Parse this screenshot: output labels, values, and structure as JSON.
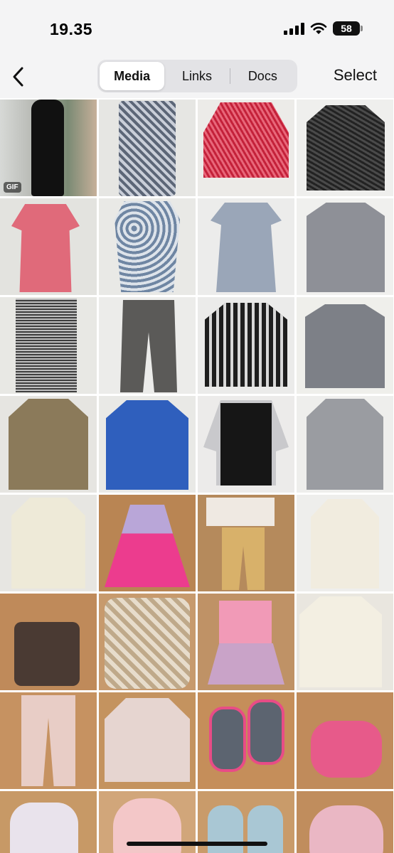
{
  "status_bar": {
    "time": "19.35",
    "battery_level": "58"
  },
  "nav": {
    "back_icon": "chevron-left-icon",
    "tabs": [
      {
        "label": "Media",
        "active": true
      },
      {
        "label": "Links",
        "active": false
      },
      {
        "label": "Docs",
        "active": false
      }
    ],
    "select_label": "Select"
  },
  "media": {
    "items": [
      {
        "kind": "black long dress",
        "badge": "GIF"
      },
      {
        "kind": "grey patterned tunic"
      },
      {
        "kind": "red lace top"
      },
      {
        "kind": "black lace peplum top"
      },
      {
        "kind": "pink child dress"
      },
      {
        "kind": "floral child dress"
      },
      {
        "kind": "grey child dress"
      },
      {
        "kind": "grey double-breasted coat"
      },
      {
        "kind": "grey tweed dress"
      },
      {
        "kind": "grey trousers"
      },
      {
        "kind": "black plaid jacket"
      },
      {
        "kind": "grey jacket"
      },
      {
        "kind": "khaki shirt dress"
      },
      {
        "kind": "blue blouse"
      },
      {
        "kind": "black dress with white collar"
      },
      {
        "kind": "grey shirt dress"
      },
      {
        "kind": "cream blouse"
      },
      {
        "kind": "pink child dress"
      },
      {
        "kind": "child top and leggings"
      },
      {
        "kind": "cream ruffle blouse"
      },
      {
        "kind": "baby carrier"
      },
      {
        "kind": "swaddle blanket set"
      },
      {
        "kind": "pink tee and skirt"
      },
      {
        "kind": "cream blouse"
      },
      {
        "kind": "pink leggings"
      },
      {
        "kind": "printed long sleeve tee"
      },
      {
        "kind": "pink grey sneakers"
      },
      {
        "kind": "sneaker detail"
      },
      {
        "kind": "unicorn shoe"
      },
      {
        "kind": "shoe sole"
      },
      {
        "kind": "unicorn sneakers"
      },
      {
        "kind": "shoe in hand"
      }
    ]
  },
  "colors": {
    "nav_bg": "#f4f4f5",
    "segment_bg": "#e3e3e6",
    "active_segment": "#ffffff"
  }
}
